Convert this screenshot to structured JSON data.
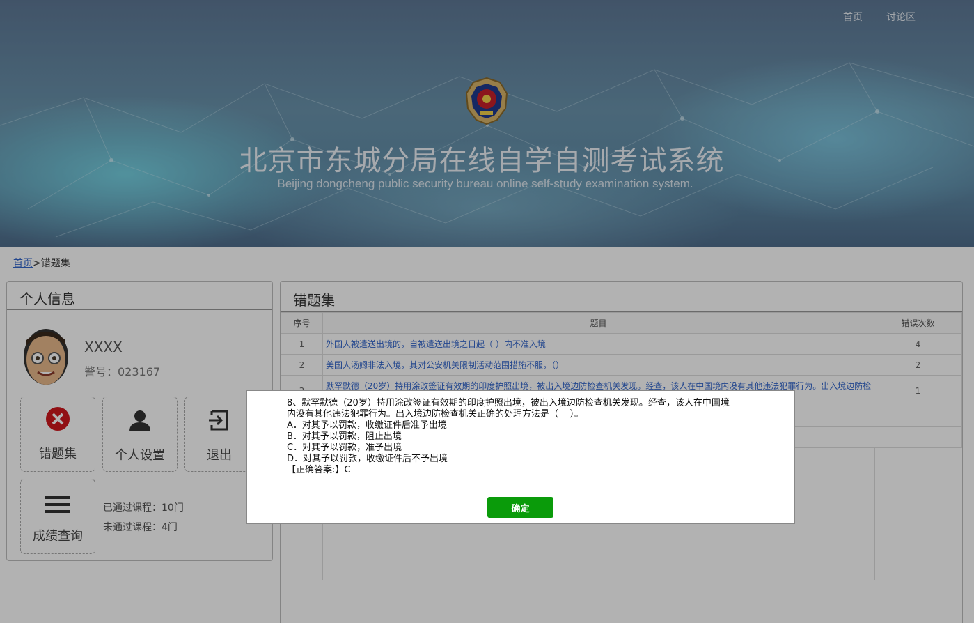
{
  "nav": {
    "home": "首页",
    "forum": "讨论区"
  },
  "banner": {
    "title": "北京市东城分局在线自学自测考试系统",
    "subtitle": "Beijing dongcheng public security bureau online self-study examination system."
  },
  "breadcrumb": {
    "home": "首页",
    "sep": ">",
    "current": "错题集"
  },
  "profile": {
    "title": "个人信息",
    "name": "XXXX",
    "badge": "警号：023167",
    "tiles": {
      "wrong": "错题集",
      "settings": "个人设置",
      "logout": "退出",
      "scores": "成绩查询"
    },
    "passed": "已通过课程：10门",
    "failed": "未通过课程：4门"
  },
  "wrongset": {
    "title": "错题集",
    "headers": {
      "no": "序号",
      "question": "题目",
      "count": "错误次数"
    },
    "rows": [
      {
        "no": "1",
        "question": "外国人被遣送出境的，自被遣送出境之日起（ ）内不准入境",
        "count": "4"
      },
      {
        "no": "2",
        "question": "美国人汤姆非法入境，其对公安机关限制活动范围措施不服，（）",
        "count": "2"
      },
      {
        "no": "3",
        "question": "默罕默德（20岁）持用涂改签证有效期的印度护照出境，被出入境边防检查机关发现。经查，该人在中国境内没有其他违法犯罪行为。出入境边防检",
        "count": "1"
      }
    ]
  },
  "modal": {
    "lines": [
      "8、默罕默德（20岁）持用涂改签证有效期的印度护照出境，被出入境边防检查机关发现。经查，该人在中国境",
      "内没有其他违法犯罪行为。出入境边防检查机关正确的处理方法是（    ）。",
      "A．对其予以罚款，收缴证件后准予出境",
      "B．对其予以罚款，阻止出境",
      "C．对其予以罚款，准予出境",
      "D．对其予以罚款，收缴证件后不予出境",
      "【正确答案:】C"
    ],
    "ok": "确定"
  },
  "colors": {
    "ok_button": "#0a9b0a",
    "link": "#3366cc",
    "error_icon": "#d0171e"
  }
}
